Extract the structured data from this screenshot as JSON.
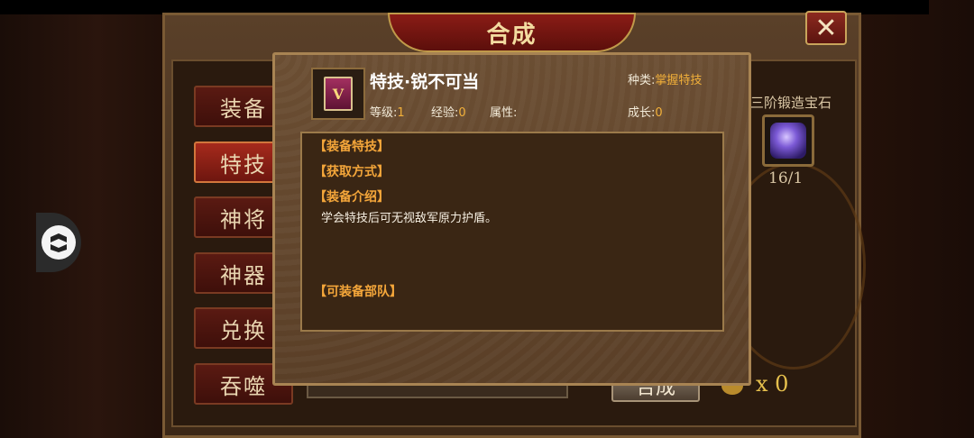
{
  "window": {
    "title": "合成",
    "close_glyph": "✕"
  },
  "tabs": [
    {
      "label": "装备",
      "active": false
    },
    {
      "label": "特技",
      "active": true
    },
    {
      "label": "神将",
      "active": false
    },
    {
      "label": "神器",
      "active": false
    },
    {
      "label": "兑换",
      "active": false
    },
    {
      "label": "吞噬",
      "active": false
    }
  ],
  "side_panel": {
    "material_name": "三阶锻造宝石",
    "material_count": "16/1",
    "currency_amount": "x 0",
    "synth_button": "合成"
  },
  "popup": {
    "item_icon_glyph": "V",
    "item_name": "特技·锐不可当",
    "type_label": "种类:",
    "type_value": "掌握特技",
    "level_label": "等级:",
    "level_value": "1",
    "exp_label": "经验:",
    "exp_value": "0",
    "attr_label": "属性:",
    "attr_value": "",
    "growth_label": "成长:",
    "growth_value": "0",
    "sections": {
      "equip_skill": "【装备特技】",
      "obtain": "【获取方式】",
      "intro": "【装备介绍】",
      "units": "【可装备部队】"
    },
    "description": "学会特技后可无视敌军原力护盾。"
  },
  "colors": {
    "accent_gold": "#f3b13a",
    "tab_active": "#a62a1c",
    "section_header": "#f4a63a"
  },
  "icons": {
    "close": "close-icon",
    "item": "skill-book-icon",
    "gem": "gem-icon",
    "coin": "coin-icon",
    "float": "assistive-touch-icon"
  }
}
